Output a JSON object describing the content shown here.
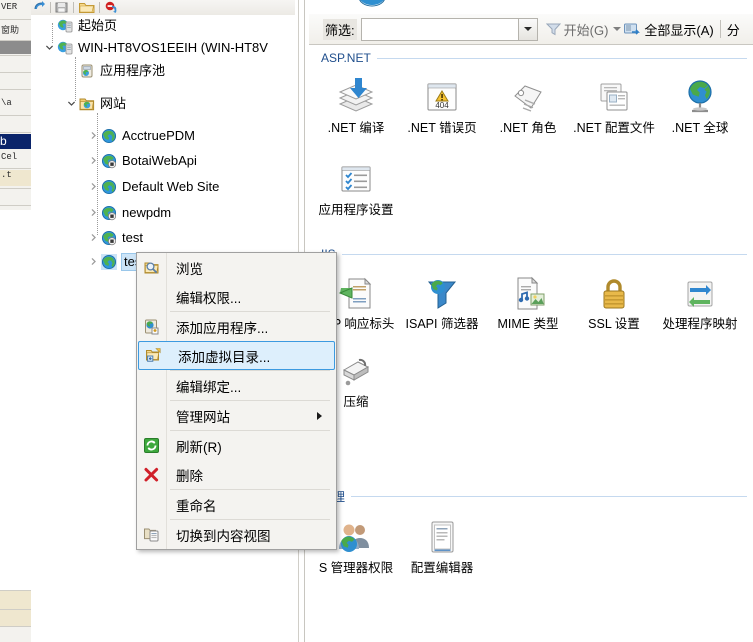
{
  "app": {
    "name": "IIS Manager",
    "accent_blue": "#1f4e8c",
    "selection_blue": "#cce4f7",
    "highlight_border": "#3c9ae0"
  },
  "toolbar": {
    "icons": [
      "back-icon",
      "save-icon",
      "folder-icon",
      "stop-icon"
    ]
  },
  "tree": {
    "nodes": [
      {
        "label": "起始页",
        "icon": "start-page-icon",
        "indent": 0,
        "expander": "none",
        "selected": false
      },
      {
        "label": "WIN-HT8VOS1EEIH (WIN-HT8V",
        "icon": "server-icon",
        "indent": 0,
        "expander": "expanded",
        "selected": false
      },
      {
        "label": "应用程序池",
        "icon": "app-pool-icon",
        "indent": 1,
        "expander": "none",
        "selected": false
      },
      {
        "label": "网站",
        "icon": "sites-folder-icon",
        "indent": 1,
        "expander": "expanded",
        "selected": false
      },
      {
        "label": "AcctruePDM",
        "icon": "website-icon",
        "indent": 2,
        "expander": "collapsed",
        "selected": false
      },
      {
        "label": "BotaiWebApi",
        "icon": "website-stopped-icon",
        "indent": 2,
        "expander": "collapsed",
        "selected": false
      },
      {
        "label": "Default Web Site",
        "icon": "website-icon",
        "indent": 2,
        "expander": "collapsed",
        "selected": false
      },
      {
        "label": "newpdm",
        "icon": "website-stopped-icon",
        "indent": 2,
        "expander": "collapsed",
        "selected": false
      },
      {
        "label": "test",
        "icon": "website-stopped-icon",
        "indent": 2,
        "expander": "collapsed",
        "selected": false
      },
      {
        "label": "testhtml",
        "icon": "website-icon",
        "indent": 2,
        "expander": "collapsed",
        "selected": true
      }
    ]
  },
  "filter": {
    "label": "筛选:",
    "value": "",
    "placeholder": "",
    "go_label": "开始(G)",
    "show_all_label": "全部显示(A)",
    "group_label": "分"
  },
  "sections": [
    {
      "title": "ASP.NET",
      "items": [
        {
          "label": ".NET 编译",
          "icon": "net-compilation-icon"
        },
        {
          "label": ".NET 错误页",
          "icon": "net-error-pages-icon"
        },
        {
          "label": ".NET 角色",
          "icon": "net-roles-icon"
        },
        {
          "label": ".NET 配置文件",
          "icon": "net-profile-icon"
        },
        {
          "label": ".NET 全球",
          "icon": "net-globalization-icon"
        },
        {
          "label": "应用程序设置",
          "icon": "app-settings-icon"
        }
      ]
    },
    {
      "title": "IIS",
      "items": [
        {
          "label": "TTP 响应标头",
          "icon": "http-response-headers-icon"
        },
        {
          "label": "ISAPI 筛选器",
          "icon": "isapi-filters-icon"
        },
        {
          "label": "MIME 类型",
          "icon": "mime-types-icon"
        },
        {
          "label": "SSL 设置",
          "icon": "ssl-settings-icon"
        },
        {
          "label": "处理程序映射",
          "icon": "handler-mappings-icon"
        },
        {
          "label": "压缩",
          "icon": "compression-icon"
        }
      ]
    },
    {
      "title": "管理",
      "items": [
        {
          "label": "S 管理器权限",
          "icon": "iis-manager-permissions-icon"
        },
        {
          "label": "配置编辑器",
          "icon": "configuration-editor-icon"
        }
      ]
    }
  ],
  "context_menu": {
    "items": [
      {
        "label": "浏览",
        "icon": "browse-icon",
        "separator_after": false,
        "highlighted": false,
        "submenu": false
      },
      {
        "label": "编辑权限...",
        "icon": "none",
        "separator_after": true,
        "highlighted": false,
        "submenu": false
      },
      {
        "label": "添加应用程序...",
        "icon": "add-application-icon",
        "separator_after": false,
        "highlighted": false,
        "submenu": false
      },
      {
        "label": "添加虚拟目录...",
        "icon": "add-virtual-directory-icon",
        "separator_after": true,
        "highlighted": true,
        "submenu": false
      },
      {
        "label": "编辑绑定...",
        "icon": "none",
        "separator_after": true,
        "highlighted": false,
        "submenu": false
      },
      {
        "label": "管理网站",
        "icon": "none",
        "separator_after": true,
        "highlighted": false,
        "submenu": true
      },
      {
        "label": "刷新(R)",
        "icon": "refresh-icon",
        "separator_after": false,
        "highlighted": false,
        "submenu": false
      },
      {
        "label": "删除",
        "icon": "delete-icon",
        "separator_after": true,
        "highlighted": false,
        "submenu": false
      },
      {
        "label": "重命名",
        "icon": "none",
        "separator_after": true,
        "highlighted": false,
        "submenu": false
      },
      {
        "label": "切换到内容视图",
        "icon": "switch-content-view-icon",
        "separator_after": false,
        "highlighted": false,
        "submenu": false
      }
    ]
  },
  "background_window": {
    "fragments": [
      "VER",
      "窗助",
      "\\a",
      "b",
      "Cel",
      ".t"
    ]
  }
}
